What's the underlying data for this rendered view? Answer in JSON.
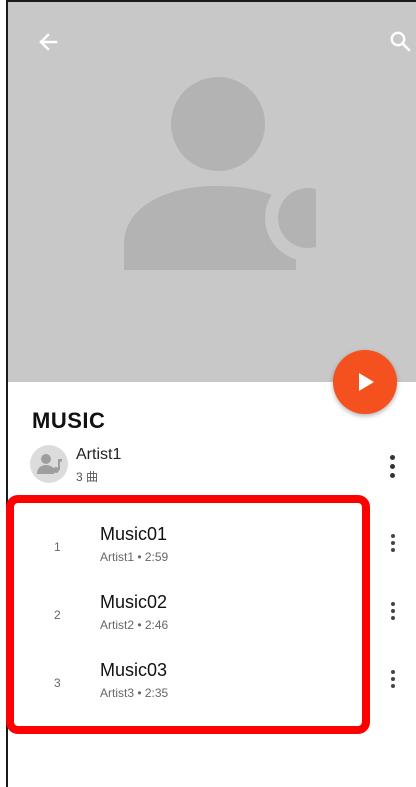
{
  "header": {
    "back_icon": "back-arrow-icon",
    "search_icon": "search-icon"
  },
  "hero": {
    "art_icon": "artist-music-placeholder-icon",
    "background_color": "#c8c8c8"
  },
  "play_button": {
    "icon": "play-icon",
    "color": "#f4511e"
  },
  "album": {
    "title": "MUSIC",
    "artist_name": "Artist1",
    "song_count": "3 曲",
    "more_icon": "more-vert-icon"
  },
  "tracks": [
    {
      "number": "1",
      "title": "Music01",
      "subtitle": "Artist1 • 2:59"
    },
    {
      "number": "2",
      "title": "Music02",
      "subtitle": "Artist2 • 2:46"
    },
    {
      "number": "3",
      "title": "Music03",
      "subtitle": "Artist3 • 2:35"
    }
  ],
  "highlight": {
    "color": "#ff0000"
  }
}
